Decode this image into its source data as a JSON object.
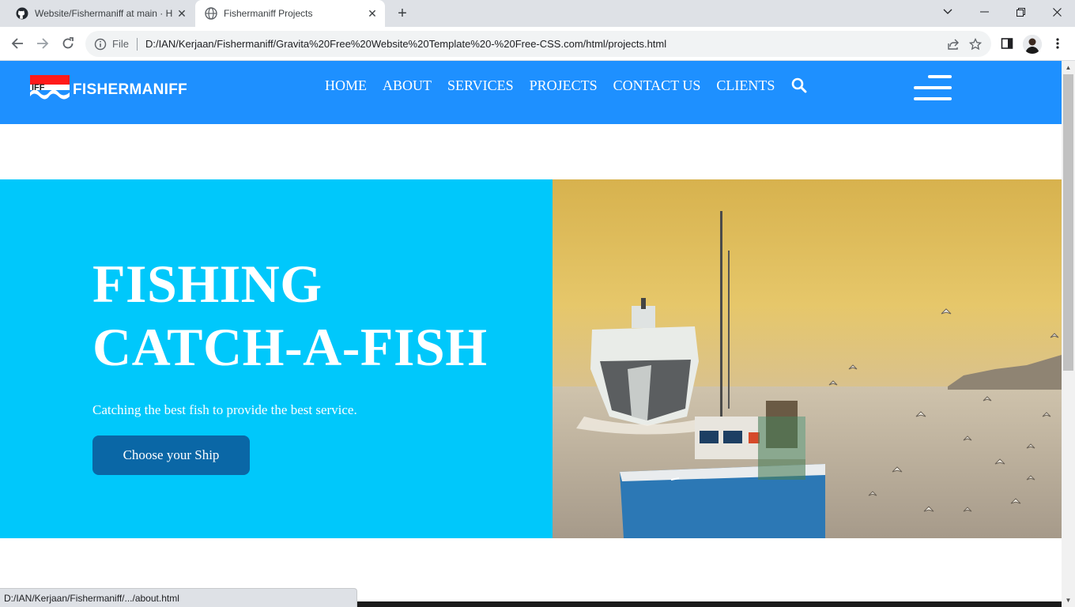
{
  "browser": {
    "tabs": [
      {
        "title": "Website/Fishermaniff at main · H",
        "icon": "github-icon",
        "active": false
      },
      {
        "title": "Fishermaniff Projects",
        "icon": "globe-icon",
        "active": true
      }
    ],
    "address": {
      "scheme_label": "File",
      "url": "D:/IAN/Kerjaan/Fishermaniff/Gravita%20Free%20Website%20Template%20-%20Free-CSS.com/html/projects.html"
    },
    "status_url": "D:/IAN/Kerjaan/Fishermaniff/.../about.html"
  },
  "site": {
    "brand": "FISHERMANIFF",
    "nav": [
      "HOME",
      "ABOUT",
      "SERVICES",
      "PROJECTS",
      "CONTACT US",
      "CLIENTS"
    ],
    "colors": {
      "header": "#1e90ff",
      "hero": "#00c8fb",
      "button": "#0a67a6"
    }
  },
  "hero": {
    "title_line1": "FISHING",
    "title_line2": "CATCH-A-FISH",
    "subtitle": "Catching the best fish to provide the best service.",
    "button": "Choose your Ship"
  }
}
